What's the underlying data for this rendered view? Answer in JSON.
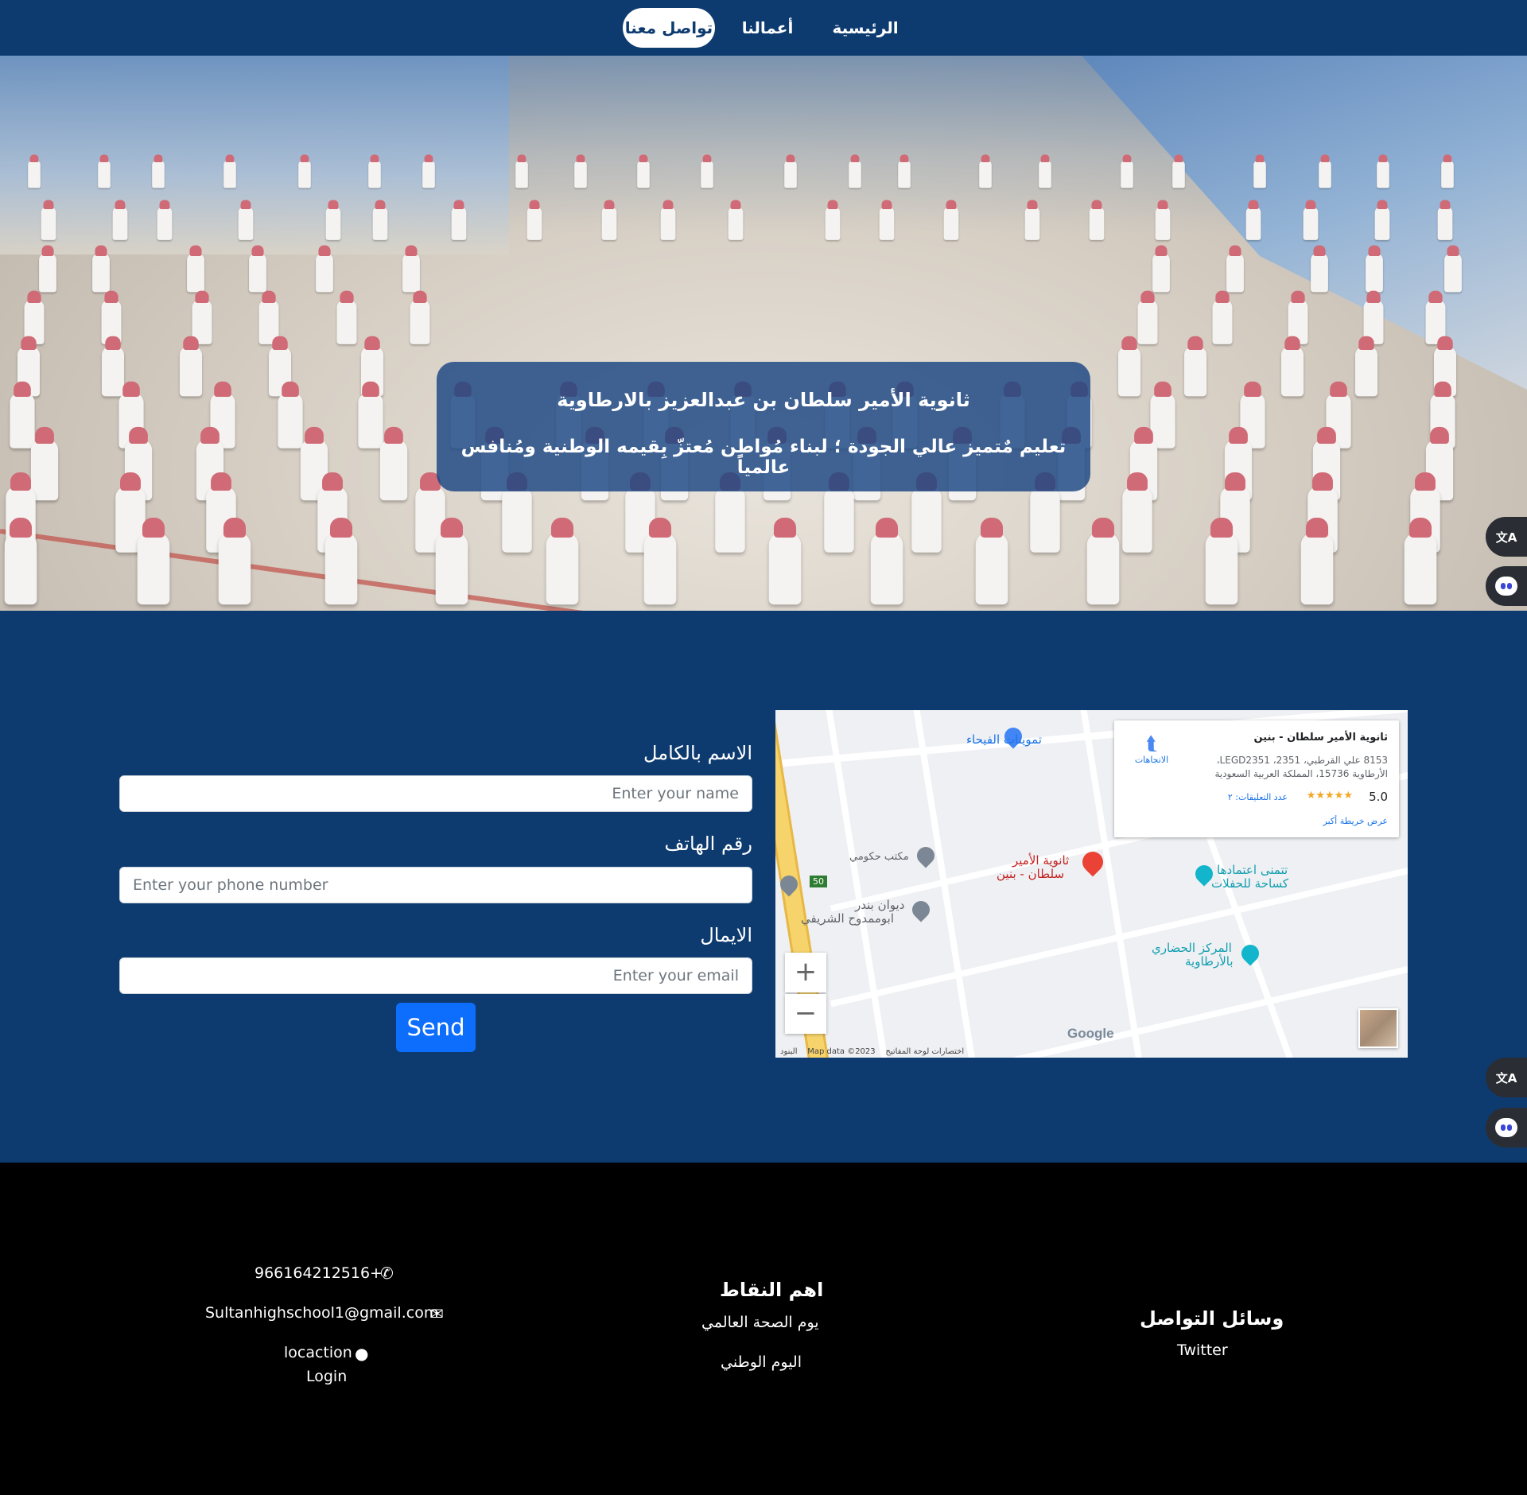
{
  "nav": {
    "items": [
      {
        "label": "الرئيسية",
        "active": false
      },
      {
        "label": "أعمالنا",
        "active": false
      },
      {
        "label": "تواصل معنا",
        "active": true
      }
    ]
  },
  "hero": {
    "title": "ثانوية الأمير سلطان بن عبدالعزيز بالارطاوية",
    "subtitle": "تعليم مٌتميز عالي الجودة ؛ لبناء مُواطن مُعتزّ بِقيمه الوطنية ومُنافس عالمياً"
  },
  "form": {
    "name_label": "الاسم بالكامل",
    "name_placeholder": "Enter your name",
    "phone_label": "رقم الهاتف",
    "phone_placeholder": "Enter your phone number",
    "email_label": "الايمال",
    "email_placeholder": "Enter your email",
    "send_label": "Send"
  },
  "map": {
    "card": {
      "title": "ثانوية الأمير سلطان - بنين",
      "address_line1": "8153 علي القرطبي، 2351، LEGD2351،",
      "address_line2": "الأرطاوية 15736، المملكة العربية السعودية",
      "rating": "5.0",
      "stars": "★★★★★",
      "reviews": "عدد التعليقات: ٢",
      "view_larger": "عرض خريطة أكبر",
      "directions": "الاتجاهات"
    },
    "places": {
      "store": "تموينات الفيحاء",
      "gov_office": "مكتب حكومي",
      "school_line1": "ثانوية الأمير",
      "school_line2": "سلطان - بنين",
      "diwan_line1": "ديوان بندر",
      "diwan_line2": "ابوممدوح الشريفي",
      "hall_line1": "تتمنى اعتمادها",
      "hall_line2": "كساحة للحفلات",
      "center_line1": "المركز الحضاري",
      "center_line2": "بالأرطاوية",
      "route_shield": "50"
    },
    "zoom_in": "+",
    "zoom_out": "−",
    "google": "Google",
    "footer_terms": "البنود",
    "footer_data": "Map data ©2023",
    "footer_shortcuts": "اختصارات لوحة المفاتيح"
  },
  "footer": {
    "phone": "966164212516+",
    "email": "Sultanhighschool1@gmail.com",
    "location": "locaction",
    "login": "Login",
    "points_heading": "اهم النقاط",
    "points": [
      "يوم الصحة العالمي",
      "اليوم الوطني"
    ],
    "social_heading": "وسائل التواصل",
    "social": [
      "Twitter"
    ]
  },
  "floating": {
    "translate_glyph": "文A"
  },
  "colors": {
    "navy": "#0d3b70",
    "primary_button": "#0d6efd",
    "footer_bg": "#000000",
    "map_pin_red": "#ea4335"
  }
}
